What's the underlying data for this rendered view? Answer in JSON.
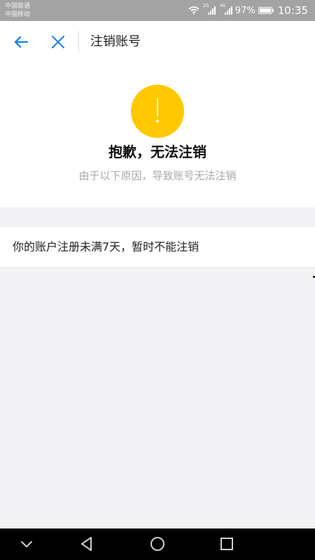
{
  "status_bar": {
    "carrier_1": "中国联通",
    "carrier_2": "中国移动",
    "sim1_tag": "2G",
    "sim2_tag": "4G",
    "battery": "97%",
    "time": "10:35"
  },
  "nav": {
    "title": "注销账号",
    "accent_color": "#1e88e5"
  },
  "hero": {
    "icon": "warning-icon",
    "icon_color": "#ffc800",
    "title": "抱歉，无法注销",
    "subtitle": "由于以下原因，导致账号无法注销"
  },
  "reasons": [
    {
      "text": "你的账户注册未满7天，暂时不能注销"
    }
  ],
  "system_nav": {
    "icons": [
      "collapse-icon",
      "back-triangle-icon",
      "home-circle-icon",
      "recents-square-icon"
    ]
  }
}
